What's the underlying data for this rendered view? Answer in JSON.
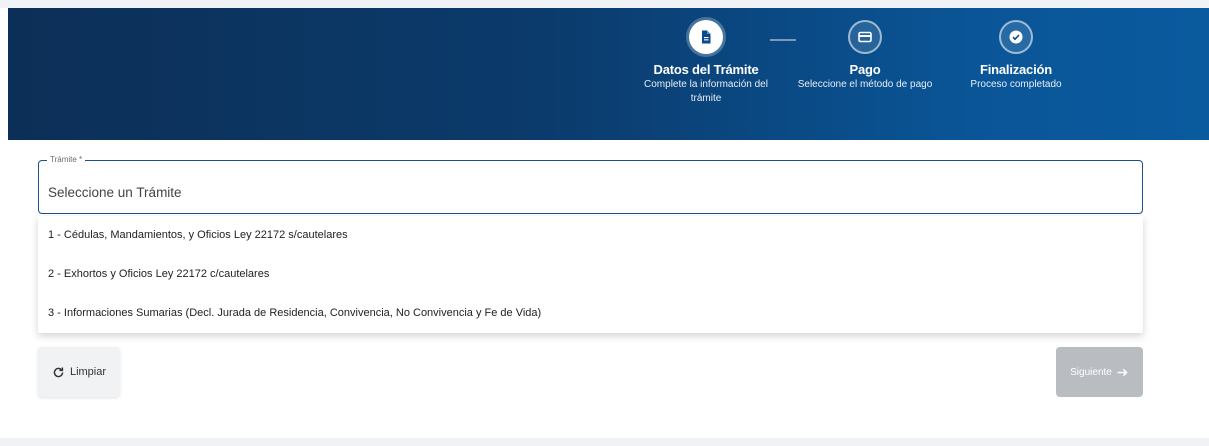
{
  "header": {
    "steps": [
      {
        "title": "Datos del Trámite",
        "desc1": "Complete la información del",
        "desc2": "trámite",
        "icon": "document-icon",
        "state": "active"
      },
      {
        "title": "Pago",
        "desc1": "Seleccione el método de pago",
        "desc2": "",
        "icon": "credit-card-icon",
        "state": "pending"
      },
      {
        "title": "Finalización",
        "desc1": "Proceso completado",
        "desc2": "",
        "icon": "check-circle-icon",
        "state": "pending"
      }
    ]
  },
  "form": {
    "tramite_label": "Trámite *",
    "tramite_placeholder": "Seleccione un Trámite",
    "options": [
      "1 - Cédulas, Mandamientos, y Oficios Ley 22172 s/cautelares",
      "2 - Exhortos y Oficios Ley 22172 c/cautelares",
      "3 - Informaciones Sumarias (Decl. Jurada de Residencia, Convivencia, No Convivencia y Fe de Vida)"
    ]
  },
  "buttons": {
    "clear_label": "Limpiar",
    "clear_icon": "refresh-icon",
    "next_label": "Siguiente",
    "next_icon": "arrow-right-icon"
  },
  "colors": {
    "header_start": "#0c2f57",
    "header_end": "#0a5a9f",
    "field_border": "#1d4f8c",
    "next_disabled": "#b9bcc1"
  }
}
